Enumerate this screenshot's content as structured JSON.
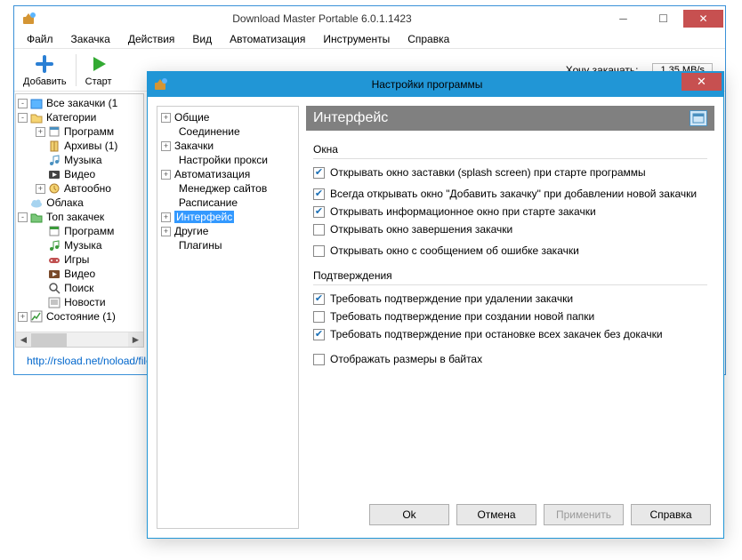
{
  "mainWindow": {
    "title": "Download Master Portable 6.0.1.1423",
    "menu": [
      "Файл",
      "Закачка",
      "Действия",
      "Вид",
      "Автоматизация",
      "Инструменты",
      "Справка"
    ],
    "toolbar": {
      "add": "Добавить",
      "start": "Старт"
    },
    "wantDownload": "Хочу закачать:",
    "speed": "1.35 MB/s",
    "tree": [
      {
        "level": 0,
        "exp": "-",
        "icon": "all",
        "label": "Все закачки (1"
      },
      {
        "level": 0,
        "exp": "-",
        "icon": "cat",
        "label": "Категории"
      },
      {
        "level": 1,
        "exp": "+",
        "icon": "prog",
        "label": "Программ"
      },
      {
        "level": 1,
        "exp": null,
        "icon": "arch",
        "label": "Архивы (1)"
      },
      {
        "level": 1,
        "exp": null,
        "icon": "music",
        "label": "Музыка"
      },
      {
        "level": 1,
        "exp": null,
        "icon": "video",
        "label": "Видео"
      },
      {
        "level": 1,
        "exp": "+",
        "icon": "auto",
        "label": "Автообно"
      },
      {
        "level": 0,
        "exp": null,
        "icon": "cloud",
        "label": "Облака"
      },
      {
        "level": 0,
        "exp": "-",
        "icon": "top",
        "label": "Топ закачек"
      },
      {
        "level": 1,
        "exp": null,
        "icon": "prog2",
        "label": "Программ"
      },
      {
        "level": 1,
        "exp": null,
        "icon": "music2",
        "label": "Музыка"
      },
      {
        "level": 1,
        "exp": null,
        "icon": "games",
        "label": "Игры"
      },
      {
        "level": 1,
        "exp": null,
        "icon": "video2",
        "label": "Видео"
      },
      {
        "level": 1,
        "exp": null,
        "icon": "search",
        "label": "Поиск"
      },
      {
        "level": 1,
        "exp": null,
        "icon": "news",
        "label": "Новости"
      },
      {
        "level": 0,
        "exp": "+",
        "icon": "state",
        "label": "Состояние (1)"
      }
    ],
    "linkText": "http://rsload.net/noload/file"
  },
  "dialog": {
    "title": "Настройки программы",
    "headerTitle": "Интерфейс",
    "tree": [
      {
        "exp": "+",
        "label": "Общие"
      },
      {
        "exp": null,
        "label": "Соединение"
      },
      {
        "exp": "+",
        "label": "Закачки"
      },
      {
        "exp": null,
        "label": "Настройки прокси"
      },
      {
        "exp": "+",
        "label": "Автоматизация"
      },
      {
        "exp": null,
        "label": "Менеджер сайтов"
      },
      {
        "exp": null,
        "label": "Расписание"
      },
      {
        "exp": "+",
        "label": "Интерфейс",
        "selected": true
      },
      {
        "exp": "+",
        "label": "Другие"
      },
      {
        "exp": null,
        "label": "Плагины"
      }
    ],
    "groups": {
      "windows": {
        "title": "Окна",
        "items": [
          {
            "checked": true,
            "label": "Открывать окно заставки (splash screen) при старте программы"
          },
          {
            "checked": true,
            "label": "Всегда открывать окно \"Добавить закачку\" при добавлении новой закачки"
          },
          {
            "checked": true,
            "label": "Открывать информационное окно при старте закачки"
          },
          {
            "checked": false,
            "label": "Открывать окно завершения закачки"
          },
          {
            "checked": false,
            "label": "Открывать окно с сообщением об ошибке закачки"
          }
        ]
      },
      "confirm": {
        "title": "Подтверждения",
        "items": [
          {
            "checked": true,
            "label": "Требовать подтверждение при удалении закачки"
          },
          {
            "checked": false,
            "label": "Требовать подтверждение при создании новой папки"
          },
          {
            "checked": true,
            "label": "Требовать подтверждение при остановке всех закачек без докачки"
          }
        ]
      },
      "bytes": {
        "checked": false,
        "label": "Отображать размеры в байтах"
      }
    },
    "buttons": {
      "ok": "Ok",
      "cancel": "Отмена",
      "apply": "Применить",
      "help": "Справка"
    }
  }
}
